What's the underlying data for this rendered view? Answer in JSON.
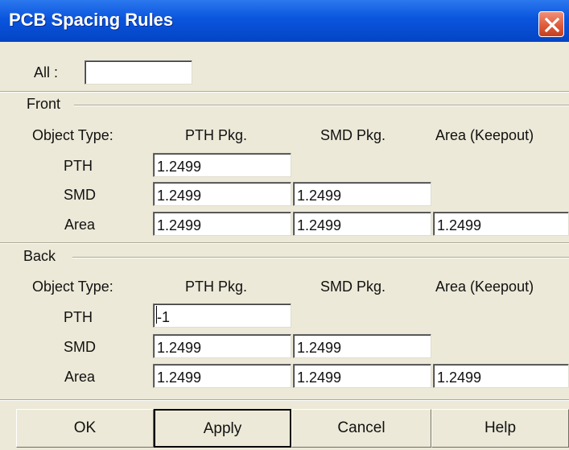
{
  "window": {
    "title": "PCB Spacing Rules",
    "close_icon": "close-icon"
  },
  "all": {
    "label": "All :",
    "value": ""
  },
  "columns": {
    "object_type": "Object Type:",
    "pth_pkg": "PTH Pkg.",
    "smd_pkg": "SMD Pkg.",
    "area": "Area (Keepout)"
  },
  "rows": {
    "pth": "PTH",
    "smd": "SMD",
    "area": "Area"
  },
  "front": {
    "label": "Front",
    "pth": {
      "pth_pkg": "1.2499"
    },
    "smd": {
      "pth_pkg": "1.2499",
      "smd_pkg": "1.2499"
    },
    "area": {
      "pth_pkg": "1.2499",
      "smd_pkg": "1.2499",
      "area": "1.2499"
    }
  },
  "back": {
    "label": "Back",
    "pth": {
      "pth_pkg": "-1"
    },
    "smd": {
      "pth_pkg": "1.2499",
      "smd_pkg": "1.2499"
    },
    "area": {
      "pth_pkg": "1.2499",
      "smd_pkg": "1.2499",
      "area": "1.2499"
    }
  },
  "buttons": {
    "ok": "OK",
    "apply": "Apply",
    "cancel": "Cancel",
    "help": "Help"
  }
}
